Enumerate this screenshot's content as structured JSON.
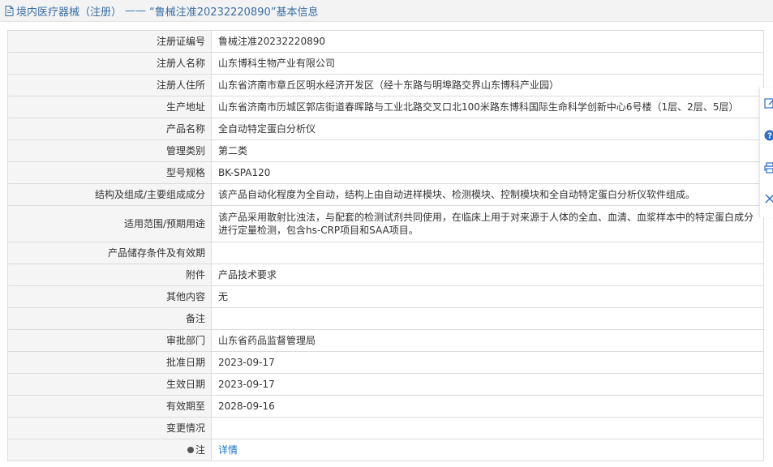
{
  "header": {
    "category": "境内医疗器械（注册）",
    "separator": "——",
    "record_title": "“鲁械注准20232220890”基本信息"
  },
  "details": [
    {
      "label": "注册证编号",
      "value": "鲁械注准20232220890"
    },
    {
      "label": "注册人名称",
      "value": "山东博科生物产业有限公司"
    },
    {
      "label": "注册人住所",
      "value": "山东省济南市章丘区明水经济开发区（经十东路与明埠路交界山东博科产业园）"
    },
    {
      "label": "生产地址",
      "value": "山东省济南市历城区郭店街道春晖路与工业北路交叉口北100米路东博科国际生命科学创新中心6号楼（1层、2层、5层）"
    },
    {
      "label": "产品名称",
      "value": "全自动特定蛋白分析仪"
    },
    {
      "label": "管理类别",
      "value": "第二类"
    },
    {
      "label": "型号规格",
      "value": "BK-SPA120"
    },
    {
      "label": "结构及组成/主要组成成分",
      "value": "该产品自动化程度为全自动，结构上由自动进样模块、检测模块、控制模块和全自动特定蛋白分析仪软件组成。"
    },
    {
      "label": "适用范围/预期用途",
      "value": "该产品采用散射比浊法，与配套的检测试剂共同使用，在临床上用于对来源于人体的全血、血清、血浆样本中的特定蛋白成分进行定量检测，包含hs-CRP项目和SAA项目。"
    },
    {
      "label": "产品储存条件及有效期",
      "value": ""
    },
    {
      "label": "附件",
      "value": "产品技术要求"
    },
    {
      "label": "其他内容",
      "value": "无"
    },
    {
      "label": "备注",
      "value": ""
    },
    {
      "label": "审批部门",
      "value": "山东省药品监督管理局"
    },
    {
      "label": "批准日期",
      "value": "2023-09-17"
    },
    {
      "label": "生效日期",
      "value": "2023-09-17"
    },
    {
      "label": "有效期至",
      "value": "2028-09-16"
    },
    {
      "label": "变更情况",
      "value": ""
    }
  ],
  "note": {
    "label": "注",
    "link_text": "详情"
  },
  "sidebar": {
    "icons": [
      "edit-icon",
      "help-icon",
      "print-icon",
      "close-icon"
    ]
  },
  "colors": {
    "title_text": "#3a6ea5",
    "label_bg": "#f5f5f5",
    "border": "#dcdcdc",
    "link": "#1a73c8",
    "sidebar_icon": "#2a6fcf"
  }
}
